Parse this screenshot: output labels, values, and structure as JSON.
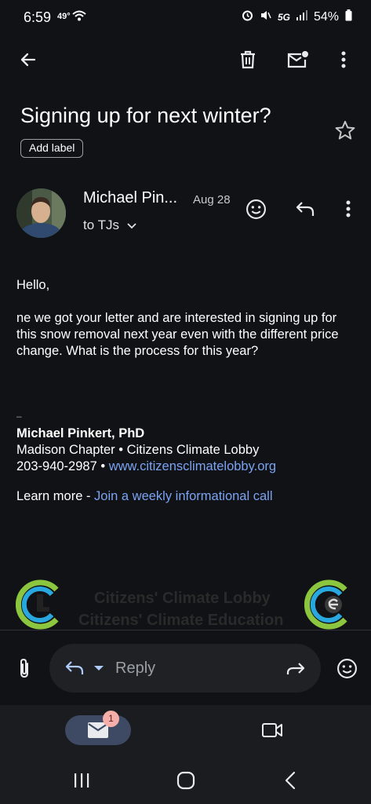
{
  "status_bar": {
    "time": "6:59",
    "temperature": "49°",
    "network": "5G",
    "battery": "54%"
  },
  "email": {
    "subject": "Signing up for next winter?",
    "label_button": "Add label",
    "sender_name": "Michael Pin...",
    "date": "Aug 28",
    "recipient": "to TJs",
    "body": {
      "greeting": "Hello,",
      "paragraph": "ne we got your letter and are interested in signing up for this snow removal next year even with the different price change.  What is the process for this year?",
      "separator": "–",
      "signature_name": "Michael Pinkert, PhD",
      "signature_org": "Madison Chapter • Citizens Climate Lobby",
      "signature_phone": "203-940-2987 • ",
      "signature_url": "www.citizensclimatelobby.org",
      "learn_more_prefix": "Learn more - ",
      "learn_more_link": "Join a weekly informational call"
    },
    "logo_lines": [
      "Citizens' Climate Lobby",
      "Citizens' Climate Education"
    ]
  },
  "reply_bar": {
    "reply_label": "Reply"
  },
  "bottom_nav": {
    "mail_badge_count": "1"
  },
  "icons": [
    "back-arrow-icon",
    "trash-icon",
    "mark-unread-icon",
    "more-vert-icon",
    "star-icon",
    "emoji-icon",
    "reply-icon",
    "attach-icon",
    "forward-icon",
    "mail-icon",
    "video-icon",
    "recents-icon",
    "home-icon",
    "nav-back-icon"
  ],
  "colors": {
    "background": "#111216",
    "link": "#7aa3f2",
    "badge": "#f6aea9",
    "nav_pill": "#3e4a63"
  }
}
